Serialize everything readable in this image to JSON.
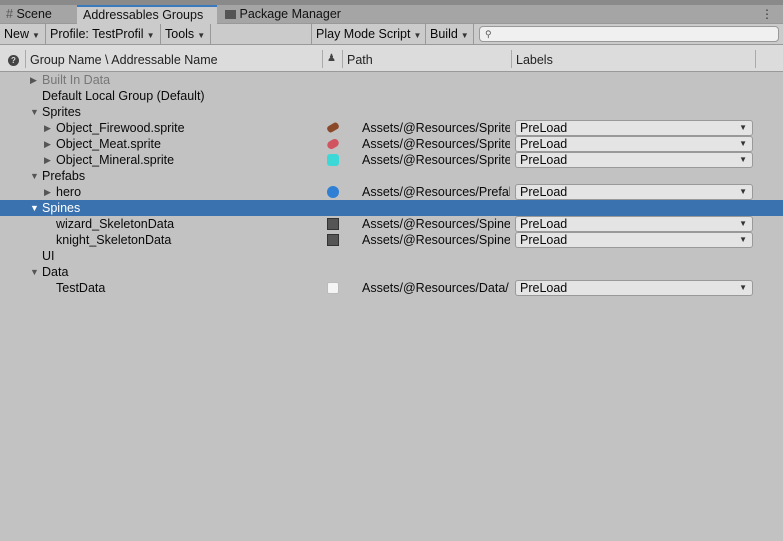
{
  "tabs": [
    {
      "label": "Scene",
      "icon": "grid-icon"
    },
    {
      "label": "Addressables Groups",
      "active": true
    },
    {
      "label": "Package Manager",
      "icon": "package-icon"
    }
  ],
  "toolbar": {
    "new": "New",
    "profile": "Profile: TestProfil",
    "tools": "Tools",
    "play_mode": "Play Mode Script",
    "build": "Build",
    "search_placeholder": ""
  },
  "header": {
    "group_name": "Group Name \\ Addressable Name",
    "path": "Path",
    "labels": "Labels"
  },
  "rows": [
    {
      "name": "Built In Data",
      "level": 0,
      "expander": "collapsed",
      "dim": true
    },
    {
      "name": "Default Local Group (Default)",
      "level": 0
    },
    {
      "name": "Sprites",
      "level": 0,
      "expander": "expanded"
    },
    {
      "name": "Object_Firewood.sprite",
      "level": 1,
      "expander": "collapsed",
      "icon": "firewood-sprite-icon",
      "path": "Assets/@Resources/Sprite",
      "label": "PreLoad"
    },
    {
      "name": "Object_Meat.sprite",
      "level": 1,
      "expander": "collapsed",
      "icon": "meat-sprite-icon",
      "path": "Assets/@Resources/Sprite",
      "label": "PreLoad"
    },
    {
      "name": "Object_Mineral.sprite",
      "level": 1,
      "expander": "collapsed",
      "icon": "mineral-sprite-icon",
      "path": "Assets/@Resources/Sprite",
      "label": "PreLoad"
    },
    {
      "name": "Prefabs",
      "level": 0,
      "expander": "expanded"
    },
    {
      "name": "hero",
      "level": 1,
      "expander": "collapsed",
      "icon": "prefab-icon",
      "path": "Assets/@Resources/Prefal",
      "label": "PreLoad"
    },
    {
      "name": "Spines",
      "level": 0,
      "expander": "expanded",
      "selected": true
    },
    {
      "name": "wizard_SkeletonData",
      "level": 1,
      "icon": "skeleton-data-icon",
      "path": "Assets/@Resources/Spine",
      "label": "PreLoad"
    },
    {
      "name": "knight_SkeletonData",
      "level": 1,
      "icon": "skeleton-data-icon",
      "path": "Assets/@Resources/Spine",
      "label": "PreLoad"
    },
    {
      "name": "UI",
      "level": 0
    },
    {
      "name": "Data",
      "level": 0,
      "expander": "expanded"
    },
    {
      "name": "TestData",
      "level": 1,
      "icon": "text-asset-icon",
      "path": "Assets/@Resources/Data/",
      "label": "PreLoad"
    }
  ]
}
